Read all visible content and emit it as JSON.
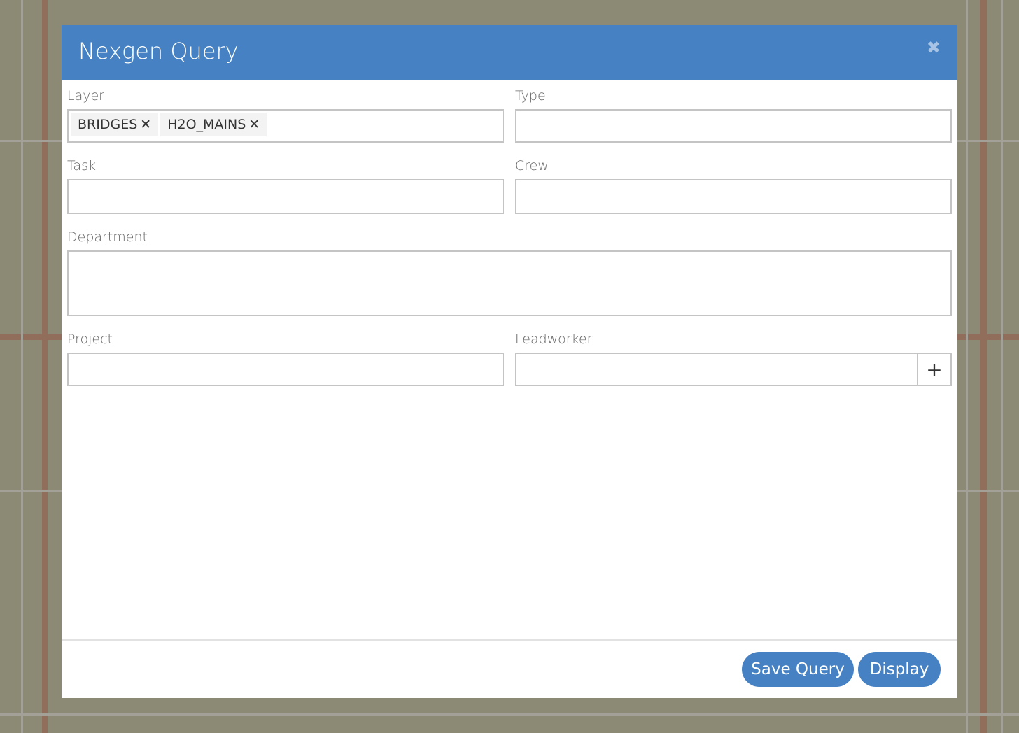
{
  "dialog": {
    "title": "Nexgen Query",
    "close_icon": "close-icon",
    "accent_color": "#4682c3"
  },
  "fields": {
    "layer": {
      "label": "Layer",
      "chips": [
        "BRIDGES",
        "H2O_MAINS"
      ],
      "remove_glyph": "✕"
    },
    "type": {
      "label": "Type",
      "value": ""
    },
    "task": {
      "label": "Task",
      "value": ""
    },
    "crew": {
      "label": "Crew",
      "value": ""
    },
    "department": {
      "label": "Department",
      "value": ""
    },
    "project": {
      "label": "Project",
      "value": ""
    },
    "leadworker": {
      "label": "Leadworker",
      "value": "",
      "add_glyph": "+"
    }
  },
  "footer": {
    "save_label": "Save Query",
    "display_label": "Display"
  }
}
